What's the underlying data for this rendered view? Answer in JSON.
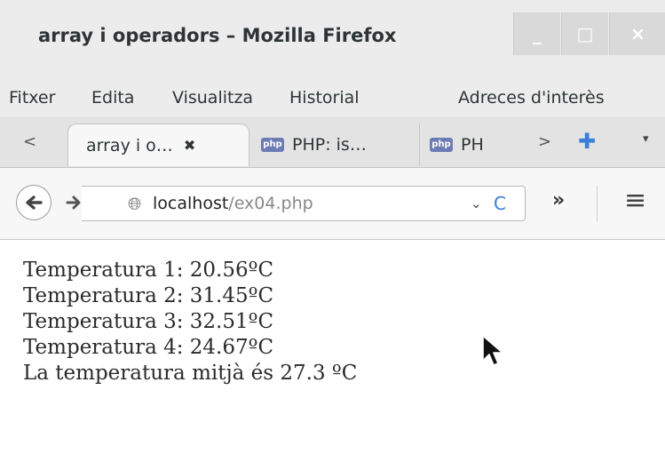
{
  "window": {
    "title": "array i operadors – Mozilla Firefox",
    "min_label": "_",
    "max_label": "□",
    "close_label": "×"
  },
  "menu": {
    "items": [
      "Fitxer",
      "Edita",
      "Visualitza",
      "Historial",
      "Adreces d'interès"
    ]
  },
  "tabs": {
    "scroll_left": "<",
    "items": [
      {
        "label": "array i o…",
        "close": "✖"
      },
      {
        "label": "PHP: is…",
        "icon_text": "php"
      },
      {
        "label": "PH",
        "icon_text": "php"
      }
    ],
    "scroll_right": ">",
    "new_tab": "✚",
    "list_all": "▾"
  },
  "navigation": {
    "url_host": "localhost",
    "url_path": "/ex04.php",
    "dropdown": "⌄",
    "reload": "C",
    "overflow": "»",
    "menu": "≡"
  },
  "page": {
    "lines": [
      "Temperatura 1: 20.56ºC",
      "Temperatura 2: 31.45ºC",
      "Temperatura 3: 32.51ºC",
      "Temperatura 4: 24.67ºC",
      "La temperatura mitjà és 27.3 ºC"
    ]
  },
  "icons": {
    "back": "arrow-left-icon",
    "forward": "arrow-right-icon",
    "site": "globe-icon",
    "cursor": "mouse-pointer-icon"
  }
}
